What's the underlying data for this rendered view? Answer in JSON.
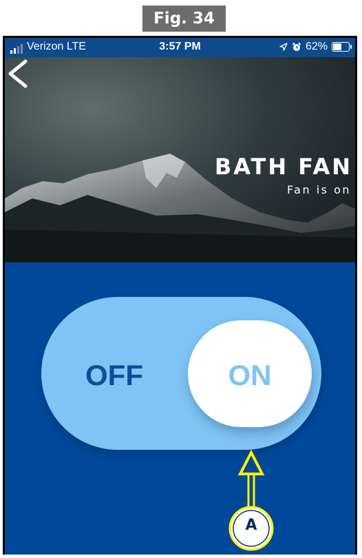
{
  "figure_label": "Fig. 34",
  "status_bar": {
    "carrier": "Verizon  LTE",
    "time": "3:57 PM",
    "battery": "62%",
    "battery_level": 0.62,
    "icons": [
      "signal-icon",
      "location-arrow-icon",
      "alarm-clock-icon",
      "battery-icon"
    ]
  },
  "header": {
    "back_icon": "chevron-left-icon",
    "title": "BATH FAN",
    "subtitle": "Fan is on"
  },
  "toggle": {
    "off_label": "OFF",
    "on_label": "ON",
    "state": "on"
  },
  "callout": {
    "letter": "A",
    "color": "#fff200"
  },
  "colors": {
    "background": "#02489a",
    "toggle_track": "#7fc4f4",
    "off_text": "#0a4f98",
    "knob": "#ffffff"
  }
}
